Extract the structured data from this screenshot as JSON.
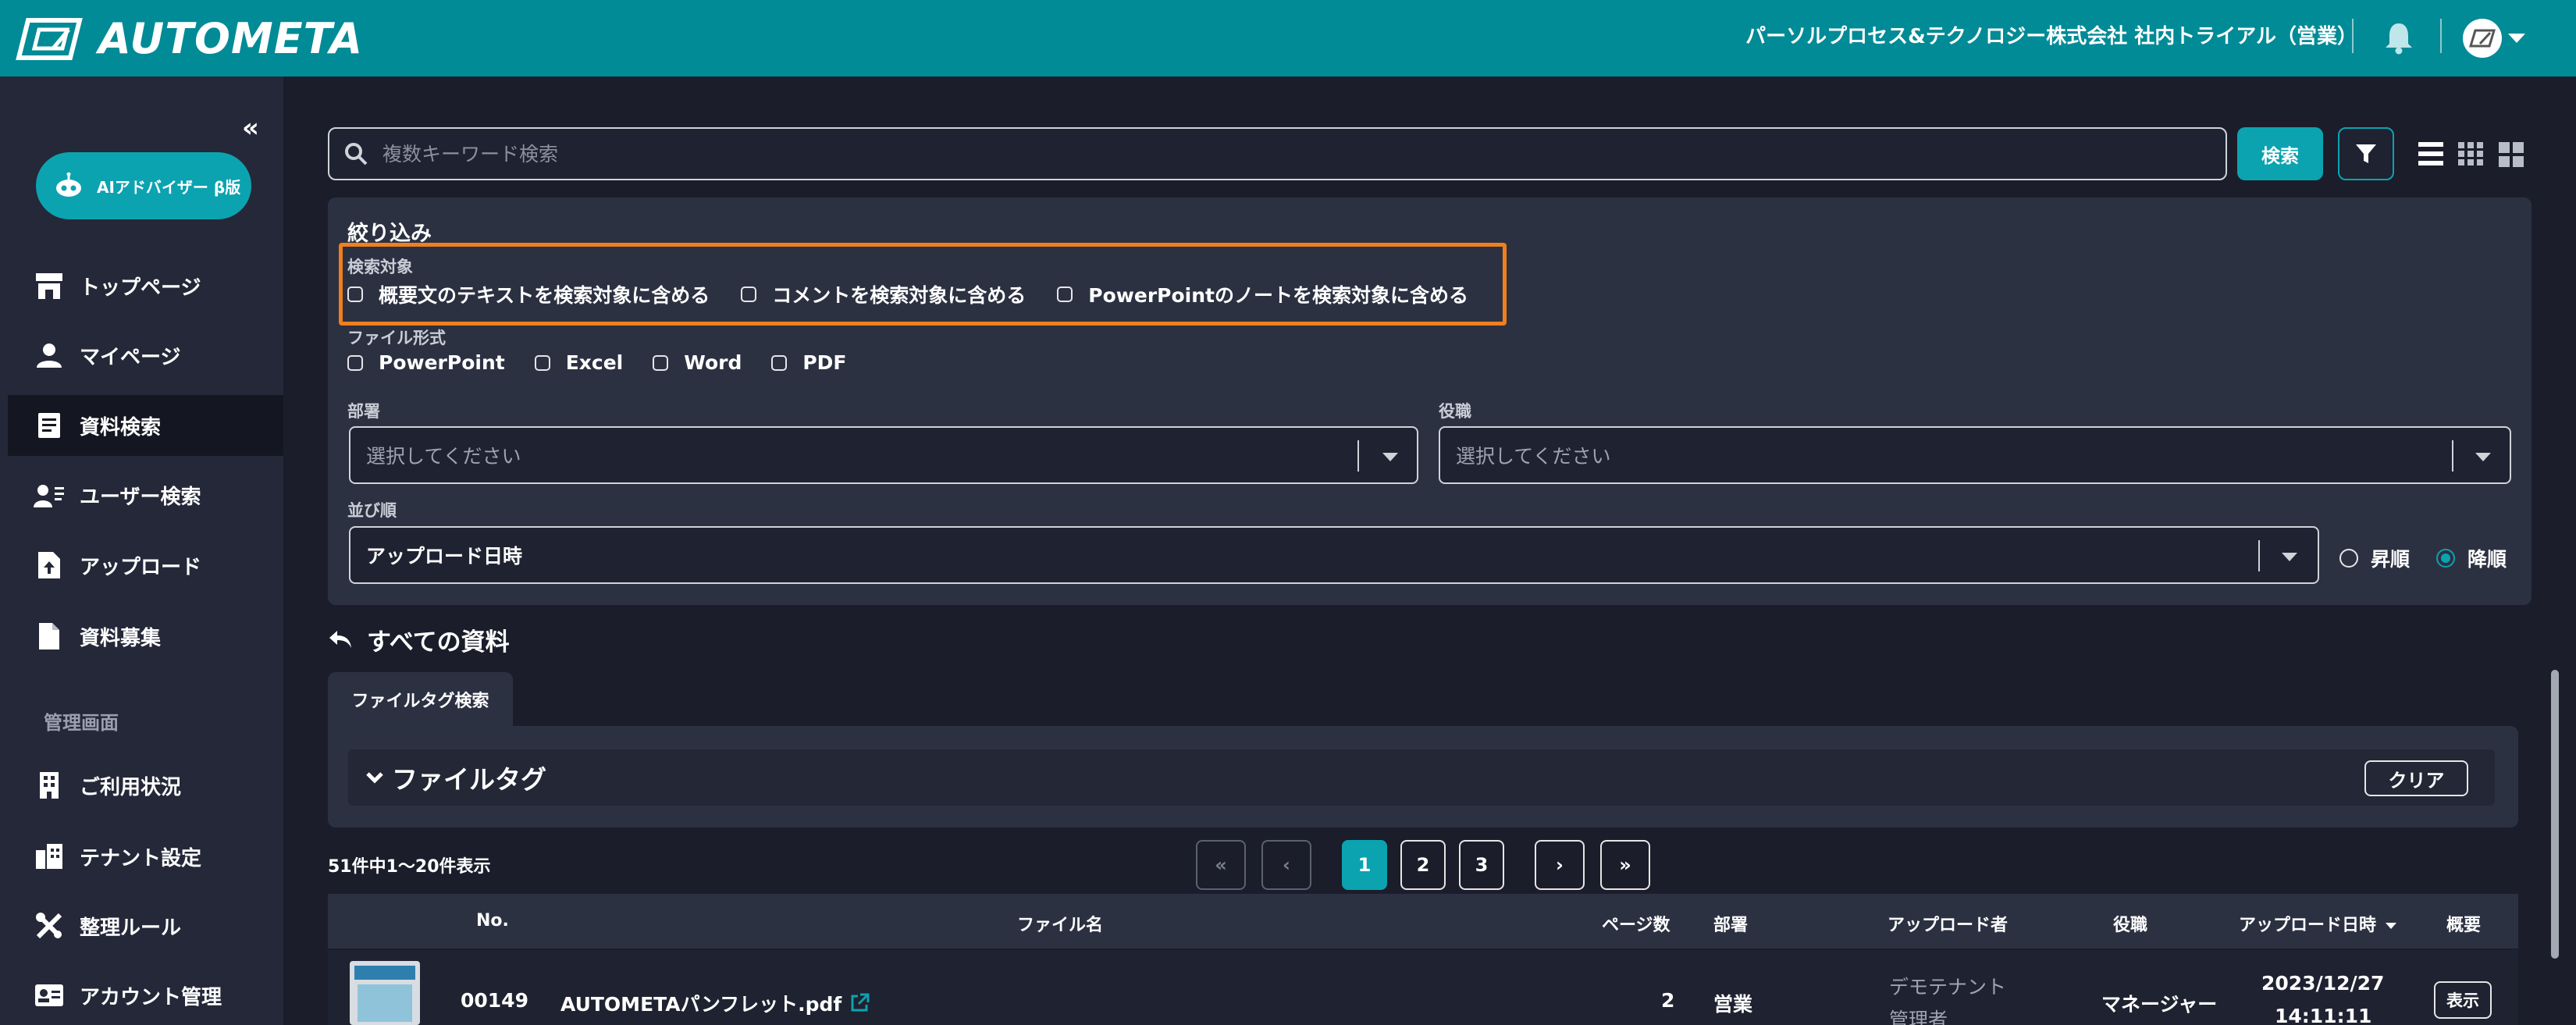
{
  "header": {
    "logo_text": "AUTOMETA",
    "company": "パーソルプロセス&テクノロジー株式会社 社内トライアル（営業）"
  },
  "sidebar": {
    "collapse": "«",
    "ai_button": "AIアドバイザー β版",
    "items": [
      {
        "label": "トップページ"
      },
      {
        "label": "マイページ"
      },
      {
        "label": "資料検索"
      },
      {
        "label": "ユーザー検索"
      },
      {
        "label": "アップロード"
      },
      {
        "label": "資料募集"
      }
    ],
    "admin_title": "管理画面",
    "admin_items": [
      {
        "label": "ご利用状況"
      },
      {
        "label": "テナント設定"
      },
      {
        "label": "整理ルール"
      },
      {
        "label": "アカウント管理"
      }
    ]
  },
  "search": {
    "placeholder": "複数キーワード検索",
    "button": "検索"
  },
  "filter": {
    "title": "絞り込み",
    "target_label": "検索対象",
    "targets": [
      "概要文のテキストを検索対象に含める",
      "コメントを検索対象に含める",
      "PowerPointのノートを検索対象に含める"
    ],
    "format_label": "ファイル形式",
    "formats": [
      "PowerPoint",
      "Excel",
      "Word",
      "PDF"
    ],
    "dept_label": "部署",
    "dept_placeholder": "選択してください",
    "role_label": "役職",
    "role_placeholder": "選択してください",
    "sort_label": "並び順",
    "sort_value": "アップロード日時",
    "asc": "昇順",
    "desc": "降順"
  },
  "results": {
    "all_docs": "すべての資料",
    "tag_tab": "ファイルタグ検索",
    "tag_bar": "ファイルタグ",
    "clear": "クリア",
    "count": "51件中1〜20件表示",
    "pages": [
      "1",
      "2",
      "3"
    ],
    "first": "«",
    "prev": "‹",
    "next": "›",
    "last": "»"
  },
  "table": {
    "headers": {
      "no": "No.",
      "name": "ファイル名",
      "pages": "ページ数",
      "dept": "部署",
      "uploader": "アップロード者",
      "role": "役職",
      "date": "アップロード日時",
      "summary": "概要"
    },
    "rows": [
      {
        "no": "00149",
        "name": "AUTOMETAパンフレット.pdf",
        "pages": "2",
        "dept": "営業",
        "uploader_line1": "デモテナント",
        "uploader_line2": "管理者",
        "role": "マネージャー",
        "date": "2023/12/27",
        "time": "14:11:11",
        "action": "表示"
      }
    ]
  },
  "colors": {
    "header_bg": "#008b96",
    "accent": "#0ba3b0",
    "highlight": "#f07f1d",
    "sidebar_bg": "#242838",
    "panel_bg": "#2c3142"
  }
}
